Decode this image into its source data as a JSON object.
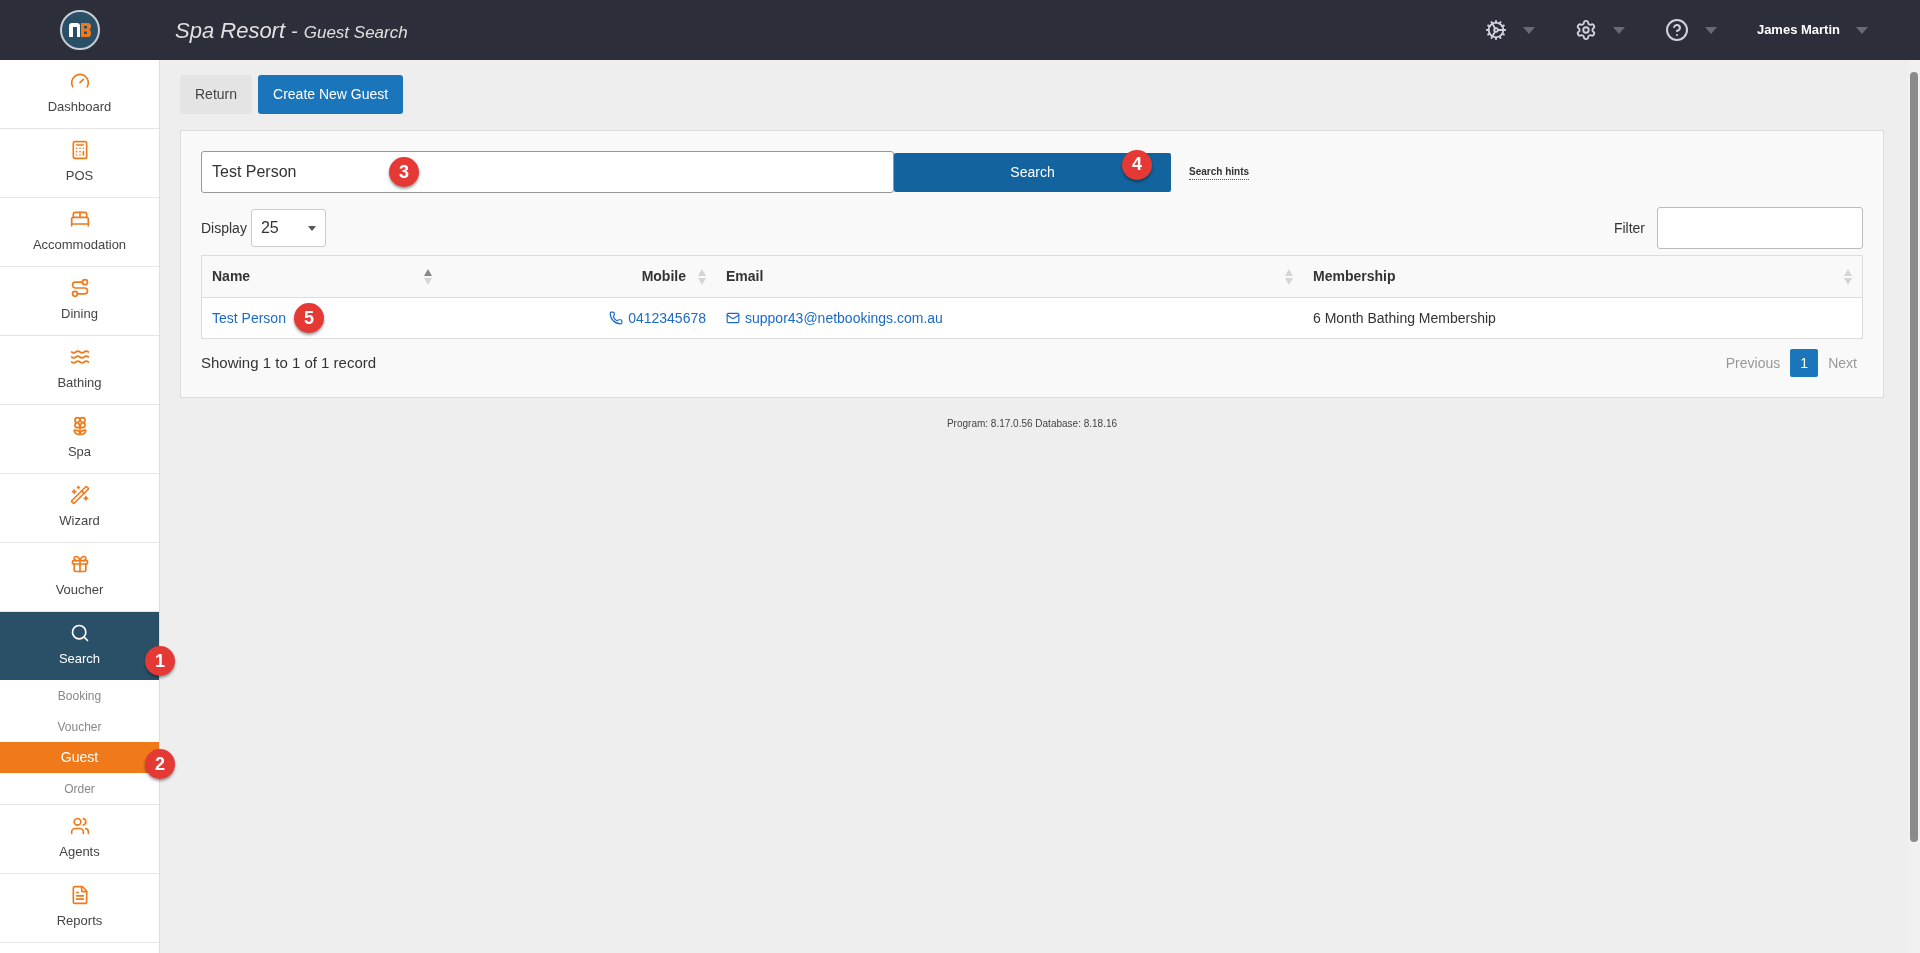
{
  "header": {
    "title": "Spa Resort",
    "separator": "-",
    "subtitle": "Guest Search",
    "user": "James Martin"
  },
  "sidebar": {
    "items": [
      {
        "label": "Dashboard",
        "selected": false
      },
      {
        "label": "POS",
        "selected": false
      },
      {
        "label": "Accommodation",
        "selected": false
      },
      {
        "label": "Dining",
        "selected": false
      },
      {
        "label": "Bathing",
        "selected": false
      },
      {
        "label": "Spa",
        "selected": false
      },
      {
        "label": "Wizard",
        "selected": false
      },
      {
        "label": "Voucher",
        "selected": false
      },
      {
        "label": "Search",
        "selected": true,
        "callout": "1",
        "children": [
          {
            "label": "Booking",
            "selected": false
          },
          {
            "label": "Voucher",
            "selected": false
          },
          {
            "label": "Guest",
            "selected": true,
            "callout": "2"
          },
          {
            "label": "Order",
            "selected": false
          }
        ]
      },
      {
        "label": "Agents",
        "selected": false
      },
      {
        "label": "Reports",
        "selected": false
      }
    ]
  },
  "toolbar": {
    "buttons": [
      "Return",
      "Create New Guest"
    ]
  },
  "search": {
    "value": "Test Person",
    "field_callout": "3",
    "button": "Search",
    "button_callout": "4",
    "hints": "Search hints"
  },
  "display": {
    "label": "Display",
    "value": "25"
  },
  "filter": {
    "label": "Filter"
  },
  "table": {
    "columns": [
      {
        "label": "Name",
        "sorted": true
      },
      {
        "label": "Mobile",
        "sorted": false
      },
      {
        "label": "Email",
        "sorted": false
      },
      {
        "label": "Membership",
        "sorted": false
      }
    ],
    "rows": [
      {
        "name": "Test Person",
        "name_callout": "5",
        "mobile": "0412345678",
        "email": "suppor43@netbookings.com.au",
        "membership": "6 Month Bathing Membership"
      }
    ]
  },
  "info": "Showing 1 to 1 of 1 record",
  "pagination": {
    "previous": "Previous",
    "next": "Next",
    "pages": [
      {
        "label": "1",
        "selected": true
      }
    ]
  },
  "footer": "Program: 8.17.0.56 Database: 8.18.16"
}
